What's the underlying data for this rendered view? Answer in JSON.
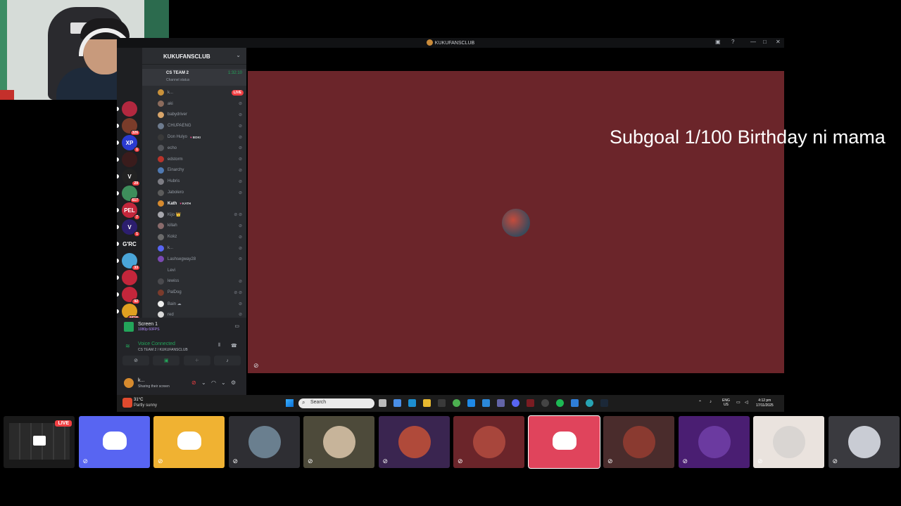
{
  "window": {
    "title": "KUKUFANSCLUB",
    "controls": [
      "—",
      "□",
      "✕"
    ]
  },
  "server": {
    "name": "KUKUFANSCLUB",
    "voice_channel": {
      "name": "CS TEAM 2",
      "status": "Channel status",
      "time": "1:32:10"
    }
  },
  "guilds": [
    {
      "badge": "",
      "color": "#b2283f",
      "label": ""
    },
    {
      "badge": "326",
      "color": "#7a3c2a",
      "label": ""
    },
    {
      "badge": "1",
      "color": "#2a3ad0",
      "label": "XP"
    },
    {
      "badge": "",
      "color": "#3a1c1c",
      "label": ""
    },
    {
      "badge": "29",
      "color": "#222",
      "label": "V"
    },
    {
      "badge": "617",
      "color": "#3e8e5b",
      "label": ""
    },
    {
      "badge": "7",
      "color": "#c3263b",
      "label": "PEL"
    },
    {
      "badge": "1",
      "color": "#2c1e6e",
      "label": "V"
    },
    {
      "badge": "",
      "color": "#1e1f22",
      "label": "G'RC"
    },
    {
      "badge": "33",
      "color": "#4aa5d8",
      "label": ""
    },
    {
      "badge": "",
      "color": "#c3263b",
      "label": ""
    },
    {
      "badge": "92",
      "color": "#c3263b",
      "label": ""
    },
    {
      "badge": "NEW",
      "color": "#e0a020",
      "label": ""
    }
  ],
  "voice_users": [
    {
      "name": "k...",
      "highlight": false,
      "tag": "",
      "icons": "⊘",
      "live": "LIVE",
      "color": "#c9913a"
    },
    {
      "name": "aki",
      "highlight": false,
      "tag": "",
      "icons": "⊘",
      "live": "",
      "color": "#8b6b5c"
    },
    {
      "name": "babydriver",
      "highlight": false,
      "tag": "",
      "icons": "⊘",
      "live": "",
      "color": "#d8a56a"
    },
    {
      "name": "CHUPAENG",
      "highlight": false,
      "tag": "",
      "icons": "⊘",
      "live": "",
      "color": "#6d7b8e"
    },
    {
      "name": "Don Hulyo",
      "highlight": false,
      "tag": "BOKI",
      "icons": "⊘",
      "live": "",
      "color": "#3a3a3a"
    },
    {
      "name": "echo",
      "highlight": false,
      "tag": "",
      "icons": "⊘",
      "live": "",
      "color": "#55575c"
    },
    {
      "name": "edstorm",
      "highlight": false,
      "tag": "",
      "icons": "⊘",
      "live": "",
      "color": "#b8342b"
    },
    {
      "name": "Einarchy",
      "highlight": false,
      "tag": "",
      "icons": "⊘",
      "live": "",
      "color": "#4f79b2"
    },
    {
      "name": "Hubris",
      "highlight": false,
      "tag": "",
      "icons": "⊘",
      "live": "",
      "color": "#7d7d84"
    },
    {
      "name": "Jabolero",
      "highlight": false,
      "tag": "",
      "icons": "⊘",
      "live": "",
      "color": "#5c5c5c"
    },
    {
      "name": "Kath",
      "highlight": true,
      "tag": "KATH",
      "icons": "",
      "live": "",
      "color": "#d68a2e"
    },
    {
      "name": "Kijo 👑",
      "highlight": false,
      "tag": "",
      "icons": "⊘ ⊘",
      "live": "",
      "color": "#a7a7ad"
    },
    {
      "name": "killah",
      "highlight": false,
      "tag": "",
      "icons": "⊘",
      "live": "",
      "color": "#8a6b6b"
    },
    {
      "name": "Kokz",
      "highlight": false,
      "tag": "",
      "icons": "⊘",
      "live": "",
      "color": "#6b6b6b"
    },
    {
      "name": "k...",
      "highlight": false,
      "tag": "",
      "icons": "⊘",
      "live": "",
      "color": "#5865f2"
    },
    {
      "name": "Lashsegway28",
      "highlight": false,
      "tag": "",
      "icons": "⊘",
      "live": "",
      "color": "#7a4ab2"
    },
    {
      "name": "Levi",
      "highlight": false,
      "tag": "",
      "icons": "",
      "live": "",
      "color": "#2b2d31"
    },
    {
      "name": "lewiss",
      "highlight": false,
      "tag": "",
      "icons": "⊘",
      "live": "",
      "color": "#4a4a4e"
    },
    {
      "name": "PalDog",
      "highlight": false,
      "tag": "",
      "icons": "⊘ ⊘",
      "live": "",
      "color": "#7a3b2c"
    },
    {
      "name": "Bain ☁",
      "highlight": false,
      "tag": "",
      "icons": "⊘",
      "live": "",
      "color": "#eeeeee"
    },
    {
      "name": "red",
      "highlight": false,
      "tag": "",
      "icons": "⊘",
      "live": "",
      "color": "#d9d9d9"
    }
  ],
  "stream_panel": {
    "title": "Screen 1",
    "subtitle": "1080p 60FPS",
    "voice_status": "Voice Connected",
    "voice_channel": "CS TEAM 2 / KUKUFANSCLUB"
  },
  "current_user": {
    "name": "k...",
    "status": "Sharing their screen"
  },
  "overlay": {
    "text": "Subgoal 1/100 Birthday ni mama"
  },
  "taskbar": {
    "weather_temp": "31°C",
    "weather_desc": "Partly sunny",
    "search_placeholder": "Search",
    "lang_1": "ENG",
    "lang_2": "US",
    "time": "4:12 pm",
    "date": "17/11/2025"
  },
  "tiles": [
    {
      "kind": "screen",
      "bg": "#1a1a1a",
      "live": "LIVE",
      "muted": false
    },
    {
      "kind": "discord",
      "bg": "#5865f2",
      "live": "",
      "muted": true
    },
    {
      "kind": "discord",
      "bg": "#f0b232",
      "live": "",
      "muted": true
    },
    {
      "kind": "avatar",
      "bg": "#2e2e33",
      "circle": "#6a7f8f",
      "live": "",
      "muted": true
    },
    {
      "kind": "avatar",
      "bg": "#4d4a3a",
      "circle": "#c7b49a",
      "live": "",
      "muted": true
    },
    {
      "kind": "avatar",
      "bg": "#3a2550",
      "circle": "#b04a3a",
      "live": "",
      "muted": true
    },
    {
      "kind": "avatar",
      "bg": "#6b252a",
      "circle": "#a8463c",
      "live": "",
      "muted": true
    },
    {
      "kind": "discord",
      "bg": "#e0445c",
      "live": "",
      "muted": false
    },
    {
      "kind": "avatar",
      "bg": "#4a2c2c",
      "circle": "#8a3a30",
      "live": "",
      "muted": true
    },
    {
      "kind": "avatar",
      "bg": "#4a1e72",
      "circle": "#6b3aa0",
      "live": "",
      "muted": true
    },
    {
      "kind": "avatar",
      "bg": "#eae3de",
      "circle": "#d9d5d2",
      "live": "",
      "muted": true
    },
    {
      "kind": "avatar",
      "bg": "#3a3a3f",
      "circle": "#c9ccd4",
      "live": "",
      "muted": true
    }
  ]
}
